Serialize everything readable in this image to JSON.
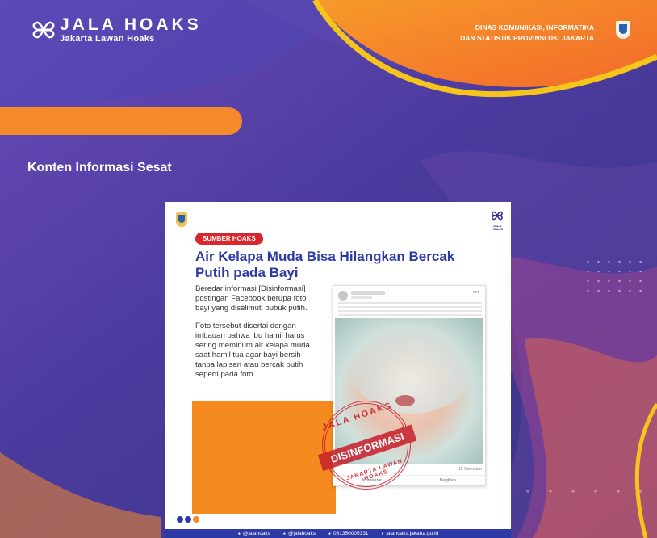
{
  "brand": {
    "name": "JALA HOAKS",
    "tagline": "Jakarta Lawan Hoaks"
  },
  "agency": {
    "line1": "DINAS KOMUNIKASI, INFORMATIKA",
    "line2": "DAN STATISTIK PROVINSI DKI JAKARTA"
  },
  "section_title": "Konten Informasi Sesat",
  "card": {
    "logo_text": "JALA HOAKS",
    "badge": "SUMBER HOAKS",
    "headline": "Air Kelapa Muda Bisa Hilangkan Bercak Putih pada Bayi",
    "para1": "Beredar informasi [Disinformasi] postingan Facebook berupa foto bayi yang diselimuti bubuk putih.",
    "para2": "Foto tersebut disertai dengan imbauan bahwa ibu hamil harus sering meminum air kelapa muda saat hamil tua agar bayi bersih tanpa lapisan atau bercak putih seperti pada foto.",
    "post": {
      "comments": "15 Komentar",
      "comment_action": "Komentar",
      "share_action": "Bagikan"
    },
    "stamp": {
      "top": "JALA HOAKS",
      "band": "DISINFORMASI",
      "bottom": "JAKARTA LAWAN HOAKS"
    },
    "footer": [
      "@jalahoaks",
      "@jalahoaks",
      "081350005331",
      "jalahoaks.jakarta.go.id"
    ]
  },
  "colors": {
    "purple": "#4a3a9c",
    "orange": "#f58a2a",
    "yellow": "#f6c51c",
    "navy": "#2d3aa6",
    "red": "#d9262c"
  }
}
